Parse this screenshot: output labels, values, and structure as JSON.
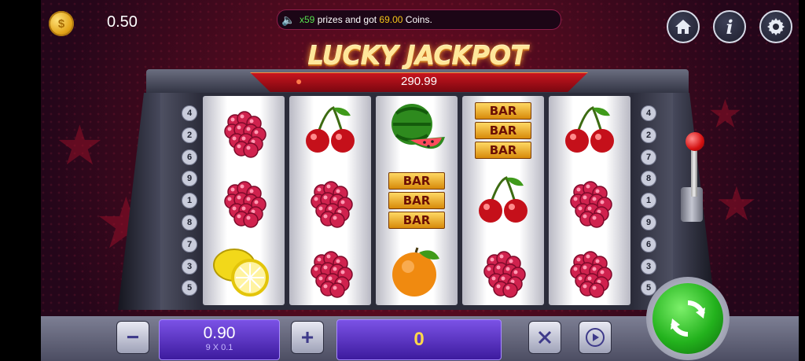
{
  "header": {
    "balance": "0.50",
    "ticker": {
      "prefix": "x59",
      "middle": " prizes and got ",
      "amount": "69.00",
      "suffix": " Coins."
    },
    "buttons": [
      {
        "name": "home-button",
        "icon": "home-icon"
      },
      {
        "name": "info-button",
        "icon": "info-icon",
        "glyph": "i"
      },
      {
        "name": "settings-button",
        "icon": "gear-icon"
      }
    ]
  },
  "title": "LUCKY JACKPOT",
  "jackpot": {
    "value": "290.99"
  },
  "paylines": {
    "left": [
      "4",
      "2",
      "6",
      "9",
      "1",
      "8",
      "7",
      "3",
      "5"
    ],
    "right": [
      "4",
      "2",
      "7",
      "8",
      "1",
      "9",
      "6",
      "3",
      "5"
    ]
  },
  "reels": [
    [
      "raspberry",
      "raspberry",
      "lemon"
    ],
    [
      "cherry",
      "raspberry",
      "raspberry"
    ],
    [
      "watermelon",
      "bar",
      "orange"
    ],
    [
      "bar",
      "cherry",
      "raspberry"
    ],
    [
      "cherry",
      "raspberry",
      "raspberry"
    ]
  ],
  "bar_label": "BAR",
  "controls": {
    "minus": "−",
    "plus": "+",
    "bet": "0.90",
    "bet_detail": "9 X 0.1",
    "win": "0"
  },
  "colors": {
    "accent": "#7b52e6",
    "jackpot_red": "#c8141e",
    "spin_green": "#23b21d"
  }
}
